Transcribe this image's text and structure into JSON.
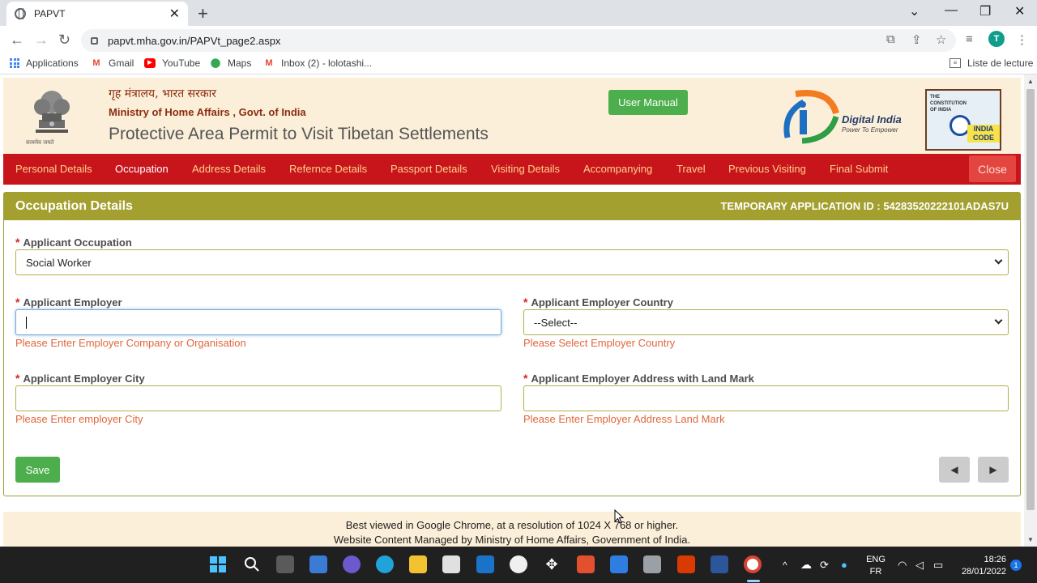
{
  "browser": {
    "tab_title": "PAPVT",
    "url": "papvt.mha.gov.in/PAPVt_page2.aspx",
    "profile_initial": "T",
    "bookmarks": [
      "Applications",
      "Gmail",
      "YouTube",
      "Maps",
      "Inbox (2) - lolotashi..."
    ],
    "reading_list": "Liste de lecture"
  },
  "header": {
    "hindi_line": "गृह मंत्रालय, भारत सरकार",
    "ministry_line": "Ministry of Home Affairs , Govt. of India",
    "site_title": "Protective Area Permit to Visit Tibetan Settlements",
    "user_manual": "User Manual",
    "digital_india": "Digital India",
    "digital_india_tag": "Power To Empower",
    "emblem_motto": "सत्यमेव जयते",
    "india_code_top": "THE CONSTITUTION OF INDIA",
    "india_code": "INDIA CODE"
  },
  "nav": {
    "items": [
      "Personal Details",
      "Occupation",
      "Address Details",
      "Refernce Details",
      "Passport Details",
      "Visiting Details",
      "Accompanying",
      "Travel",
      "Previous Visiting",
      "Final Submit"
    ],
    "active": "Occupation",
    "close": "Close"
  },
  "panel": {
    "title": "Occupation Details",
    "application_id": "TEMPORARY APPLICATION ID : 54283520222101ADAS7U"
  },
  "form": {
    "required_mark": "*",
    "occupation_label": "Applicant Occupation",
    "occupation_value": "Social Worker",
    "employer_label": "Applicant Employer",
    "employer_value": "",
    "employer_error": "Please Enter Employer Company or Organisation",
    "country_label": "Applicant Employer Country",
    "country_value": "--Select--",
    "country_error": "Please Select Employer Country",
    "city_label": "Applicant Employer City",
    "city_value": "",
    "city_error": "Please Enter employer City",
    "address_label": "Applicant Employer Address with Land Mark",
    "address_value": "",
    "address_error": "Please Enter Employer Address Land Mark",
    "save": "Save"
  },
  "footer": {
    "line1": "Best viewed in Google Chrome, at a resolution of 1024 X 768 or higher.",
    "line2": "Website Content Managed by Ministry of Home Affairs, Government of India."
  },
  "taskbar": {
    "lang_top": "ENG",
    "lang_bottom": "FR",
    "time": "18:26",
    "date": "28/01/2022",
    "notifications": "1"
  },
  "colors": {
    "nav_bg": "#c8151c",
    "panel_head": "#a3a02f",
    "header_bg": "#fcefd9",
    "button_green": "#4cae4c",
    "error_text": "#e2663a"
  }
}
